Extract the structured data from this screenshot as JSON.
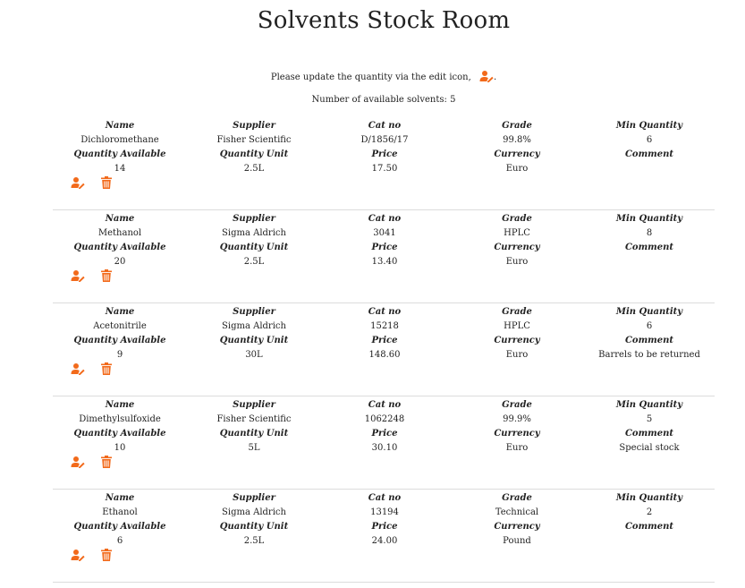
{
  "page": {
    "title": "Solvents Stock Room",
    "instruction": "Please update the quantity via the edit icon,",
    "instruction_end": ".",
    "count_label": "Number of available solvents:",
    "count_value": "5"
  },
  "colors": {
    "accent": "#f26a1b",
    "divider": "#dcdcdc"
  },
  "icons": {
    "edit": "edit-icon",
    "delete": "trash-icon"
  },
  "headers": {
    "name": "Name",
    "supplier": "Supplier",
    "cat_no": "Cat no",
    "grade": "Grade",
    "min_quantity": "Min Quantity",
    "quantity_available": "Quantity Available",
    "quantity_unit": "Quantity Unit",
    "price": "Price",
    "currency": "Currency",
    "comment": "Comment"
  },
  "solvents": [
    {
      "name": "Dichloromethane",
      "supplier": "Fisher Scientific",
      "cat_no": "D/1856/17",
      "grade": "99.8%",
      "min_quantity": "6",
      "quantity_available": "14",
      "quantity_unit": "2.5L",
      "price": "17.50",
      "currency": "Euro",
      "comment": ""
    },
    {
      "name": "Methanol",
      "supplier": "Sigma Aldrich",
      "cat_no": "3041",
      "grade": "HPLC",
      "min_quantity": "8",
      "quantity_available": "20",
      "quantity_unit": "2.5L",
      "price": "13.40",
      "currency": "Euro",
      "comment": ""
    },
    {
      "name": "Acetonitrile",
      "supplier": "Sigma Aldrich",
      "cat_no": "15218",
      "grade": "HPLC",
      "min_quantity": "6",
      "quantity_available": "9",
      "quantity_unit": "30L",
      "price": "148.60",
      "currency": "Euro",
      "comment": "Barrels to be returned"
    },
    {
      "name": "Dimethylsulfoxide",
      "supplier": "Fisher Scientific",
      "cat_no": "1062248",
      "grade": "99.9%",
      "min_quantity": "5",
      "quantity_available": "10",
      "quantity_unit": "5L",
      "price": "30.10",
      "currency": "Euro",
      "comment": "Special stock"
    },
    {
      "name": "Ethanol",
      "supplier": "Sigma Aldrich",
      "cat_no": "13194",
      "grade": "Technical",
      "min_quantity": "2",
      "quantity_available": "6",
      "quantity_unit": "2.5L",
      "price": "24.00",
      "currency": "Pound",
      "comment": ""
    }
  ]
}
